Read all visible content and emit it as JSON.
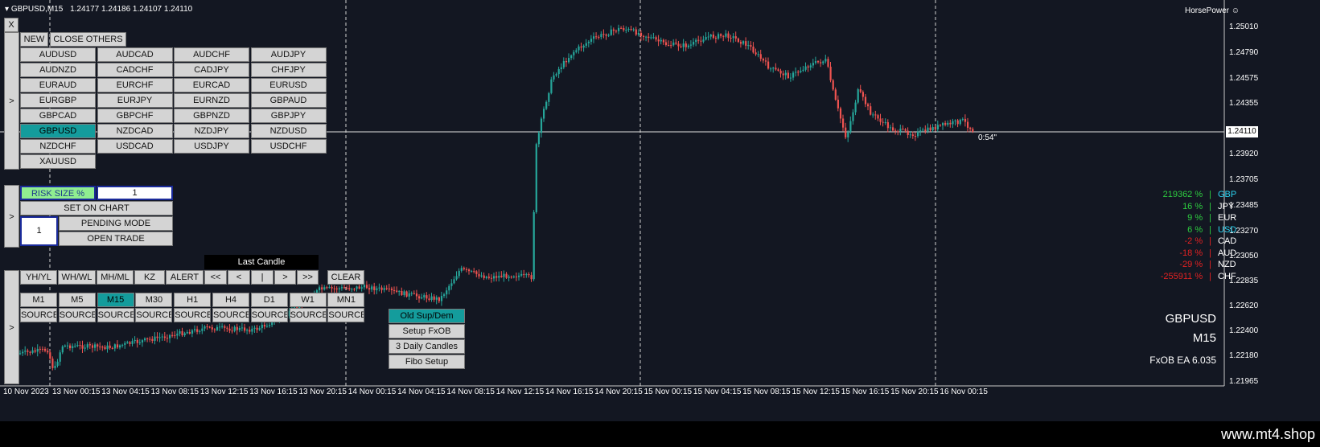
{
  "header": {
    "symbol_tf": "GBPUSD,M15",
    "ohlc": "1.24177 1.24186 1.24107 1.24110",
    "brand": "HorsePower ☺"
  },
  "close_button": "X",
  "top_buttons": {
    "new": "NEW",
    "close_others": "CLOSE OTHERS"
  },
  "pairs": [
    "AUDUSD",
    "AUDCAD",
    "AUDCHF",
    "AUDJPY",
    "AUDNZD",
    "CADCHF",
    "CADJPY",
    "CHFJPY",
    "EURAUD",
    "EURCHF",
    "EURCAD",
    "EURUSD",
    "EURGBP",
    "EURJPY",
    "EURNZD",
    "GBPAUD",
    "GBPCAD",
    "GBPCHF",
    "GBPNZD",
    "GBPJPY",
    "GBPUSD",
    "NZDCAD",
    "NZDJPY",
    "NZDUSD",
    "NZDCHF",
    "USDCAD",
    "USDJPY",
    "USDCHF",
    "XAUUSD"
  ],
  "selected_pair": "GBPUSD",
  "side_arrow": ">",
  "risk": {
    "label": "RISK SIZE %",
    "value": "1",
    "set_on_chart": "SET ON CHART",
    "lots": "1",
    "pending_mode": "PENDING MODE",
    "open_trade": "OPEN TRADE"
  },
  "last_candle": "Last Candle",
  "tools": [
    "YH/YL",
    "WH/WL",
    "MH/ML",
    "KZ",
    "ALERT",
    "<<",
    "<",
    "|",
    ">",
    ">>",
    "CLEAR"
  ],
  "timeframes": [
    "M1",
    "M5",
    "M15",
    "M30",
    "H1",
    "H4",
    "D1",
    "W1",
    "MN1"
  ],
  "selected_tf": "M15",
  "source_label": "SOURCE",
  "setup_buttons": [
    "Old Sup/Dem",
    "Setup FxOB",
    "3 Daily Candles",
    "Fibo Setup"
  ],
  "price_axis": [
    "1.25010",
    "1.24790",
    "1.24575",
    "1.24355",
    "1.24110",
    "1.23920",
    "1.23705",
    "1.23485",
    "1.23270",
    "1.23050",
    "1.22835",
    "1.22620",
    "1.22400",
    "1.22180",
    "1.21965"
  ],
  "current_price": "1.24110",
  "timer": "0:54\"",
  "time_axis": [
    "10 Nov 2023",
    "13 Nov 00:15",
    "13 Nov 04:15",
    "13 Nov 08:15",
    "13 Nov 12:15",
    "13 Nov 16:15",
    "13 Nov 20:15",
    "14 Nov 00:15",
    "14 Nov 04:15",
    "14 Nov 08:15",
    "14 Nov 12:15",
    "14 Nov 16:15",
    "14 Nov 20:15",
    "15 Nov 00:15",
    "15 Nov 04:15",
    "15 Nov 08:15",
    "15 Nov 12:15",
    "15 Nov 16:15",
    "15 Nov 20:15",
    "16 Nov 00:15"
  ],
  "currency_strength": [
    {
      "value": "219362 %",
      "sep": "|",
      "cur": "GBP",
      "vcolor": "#2ecc40",
      "ccolor": "#2bd3f0"
    },
    {
      "value": "16 %",
      "sep": "|",
      "cur": "JPY",
      "vcolor": "#2ecc40",
      "ccolor": "#ffffff"
    },
    {
      "value": "9 %",
      "sep": "|",
      "cur": "EUR",
      "vcolor": "#2ecc40",
      "ccolor": "#ffffff"
    },
    {
      "value": "6 %",
      "sep": "|",
      "cur": "USD",
      "vcolor": "#2ecc40",
      "ccolor": "#2bd3f0"
    },
    {
      "value": "-2 %",
      "sep": "|",
      "cur": "CAD",
      "vcolor": "#e32222",
      "ccolor": "#ffffff"
    },
    {
      "value": "-18 %",
      "sep": "|",
      "cur": "AUD",
      "vcolor": "#e32222",
      "ccolor": "#ffffff"
    },
    {
      "value": "-29 %",
      "sep": "|",
      "cur": "NZD",
      "vcolor": "#e32222",
      "ccolor": "#ffffff"
    },
    {
      "value": "-255911 %",
      "sep": "|",
      "cur": "CHF",
      "vcolor": "#e32222",
      "ccolor": "#ffffff"
    }
  ],
  "info": {
    "symbol": "GBPUSD",
    "tf": "M15",
    "ea": "FxOB EA 6.035"
  },
  "footer": {
    "site": "www.mt4.shop"
  },
  "colors": {
    "bull": "#26a69a",
    "bear": "#ef5350",
    "background": "#131722",
    "selected": "#149c9c"
  }
}
